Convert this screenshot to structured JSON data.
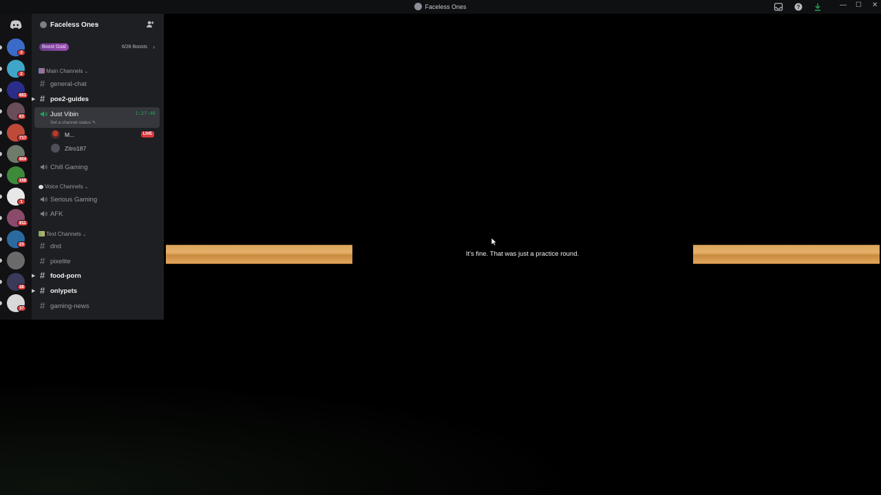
{
  "window": {
    "title": "Faceless Ones"
  },
  "rail": {
    "servers": [
      {
        "name": "server-1",
        "badge": "3",
        "color": "#3b6bc9"
      },
      {
        "name": "server-2",
        "badge": "2",
        "color": "#3fa6c9"
      },
      {
        "name": "server-3",
        "badge": "661",
        "color": "#2b2d8a"
      },
      {
        "name": "server-4",
        "badge": "63",
        "color": "#6a4d5a"
      },
      {
        "name": "server-5",
        "badge": "717",
        "color": "#c04a3a"
      },
      {
        "name": "server-6",
        "badge": "904",
        "color": "#6e7a6a"
      },
      {
        "name": "server-7",
        "badge": "168",
        "color": "#3d8a3a"
      },
      {
        "name": "server-8",
        "badge": "1",
        "color": "#e8e8e8"
      },
      {
        "name": "server-9",
        "badge": "911",
        "color": "#8a4a6a"
      },
      {
        "name": "server-10",
        "badge": "23",
        "color": "#2a6aa0"
      },
      {
        "name": "server-11",
        "badge": "",
        "color": "#6a6a6a"
      },
      {
        "name": "server-12",
        "badge": "38",
        "color": "#3a3a5a"
      },
      {
        "name": "server-13",
        "badge": "37",
        "color": "#d8d8d8"
      }
    ]
  },
  "server": {
    "name": "Faceless Ones",
    "boost": {
      "goal_label": "Boost Goal",
      "count": "6/28 Boosts"
    }
  },
  "categories": {
    "main": "Main Channels",
    "voice": "Voice Channels",
    "text": "Text Channels"
  },
  "channels": {
    "general_chat": "general-chat",
    "poe2_guides": "poe2-guides",
    "just_vibin": {
      "label": "Just Vibin",
      "status": "Set a channel status",
      "timer": "1:27:46"
    },
    "chill_gaming": "Chill Gaming",
    "serious_gaming": "Serious Gaming",
    "afk": "AFK",
    "dnd": "dnd",
    "pixelite": "pixelite",
    "food_porn": "food-porn",
    "onlypets": "onlypets",
    "gaming_news": "gaming-news"
  },
  "voice_users": [
    {
      "name": "M...",
      "live": "LIVE"
    },
    {
      "name": "Zitro187",
      "live": ""
    }
  ],
  "game": {
    "dialogue": "It's fine. That was just a practice round."
  },
  "colors": {
    "accent_live": "#da373c",
    "voice_timer": "#23a55a",
    "bar_orange": "#d9a65c"
  }
}
